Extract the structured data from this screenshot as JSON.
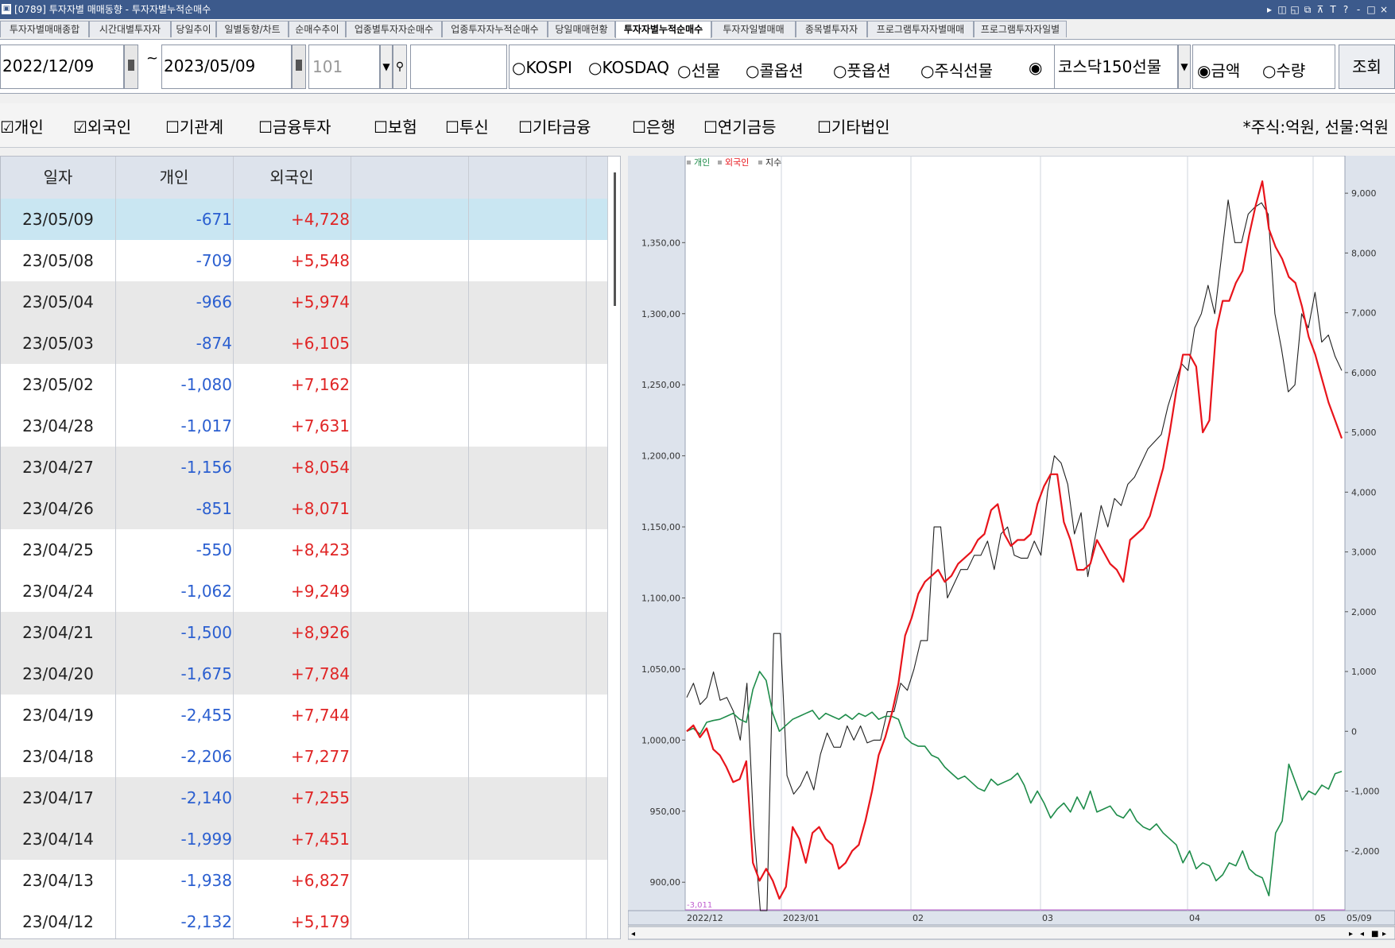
{
  "window": {
    "screen_no": "[0789]",
    "title": "투자자별 매매동향 - 투자자별누적순매수",
    "controls": [
      "▸",
      "◫",
      "◱",
      "⧉",
      "⊼",
      "T",
      "?",
      "-",
      "□",
      "×"
    ]
  },
  "tabs": [
    "투자자별매매종합",
    "시간대별투자자",
    "당일추이",
    "일별동향/차트",
    "순매수추이",
    "업종별투자자순매수",
    "업종투자자누적순매수",
    "당일매매현황",
    "투자자별누적순매수",
    "투자자일별매매",
    "종목별투자자",
    "프로그램투자자별매매",
    "프로그램투자자일별"
  ],
  "active_tab_index": 8,
  "toolbar": {
    "start_date": "2022/12/09",
    "tilde": "~",
    "end_date": "2023/05/09",
    "code": "101",
    "market_radios": [
      {
        "label": "KOSPI",
        "selected": false
      },
      {
        "label": "KOSDAQ",
        "selected": false
      },
      {
        "label": "선물",
        "selected": false
      },
      {
        "label": "콜옵션",
        "selected": false
      },
      {
        "label": "풋옵션",
        "selected": false
      },
      {
        "label": "주식선물",
        "selected": false
      }
    ],
    "extra_radio_selected": true,
    "product_select": "코스닥150선물",
    "amount_label": "금액",
    "qty_label": "수량",
    "query_button": "조회"
  },
  "investor_filters": [
    {
      "label": "개인",
      "checked": true
    },
    {
      "label": "외국인",
      "checked": true
    },
    {
      "label": "기관계",
      "checked": false
    },
    {
      "label": "금융투자",
      "checked": false
    },
    {
      "label": "보험",
      "checked": false
    },
    {
      "label": "투신",
      "checked": false
    },
    {
      "label": "기타금융",
      "checked": false
    },
    {
      "label": "은행",
      "checked": false
    },
    {
      "label": "연기금등",
      "checked": false
    },
    {
      "label": "기타법인",
      "checked": false
    }
  ],
  "unit_note": "*주식:억원, 선물:억원",
  "table": {
    "columns": [
      "일자",
      "개인",
      "외국인"
    ],
    "rows": [
      {
        "date": "23/05/09",
        "individual": "-671",
        "foreign": "+4,728"
      },
      {
        "date": "23/05/08",
        "individual": "-709",
        "foreign": "+5,548"
      },
      {
        "date": "23/05/04",
        "individual": "-966",
        "foreign": "+5,974"
      },
      {
        "date": "23/05/03",
        "individual": "-874",
        "foreign": "+6,105"
      },
      {
        "date": "23/05/02",
        "individual": "-1,080",
        "foreign": "+7,162"
      },
      {
        "date": "23/04/28",
        "individual": "-1,017",
        "foreign": "+7,631"
      },
      {
        "date": "23/04/27",
        "individual": "-1,156",
        "foreign": "+8,054"
      },
      {
        "date": "23/04/26",
        "individual": "-851",
        "foreign": "+8,071"
      },
      {
        "date": "23/04/25",
        "individual": "-550",
        "foreign": "+8,423"
      },
      {
        "date": "23/04/24",
        "individual": "-1,062",
        "foreign": "+9,249"
      },
      {
        "date": "23/04/21",
        "individual": "-1,500",
        "foreign": "+8,926"
      },
      {
        "date": "23/04/20",
        "individual": "-1,675",
        "foreign": "+7,784"
      },
      {
        "date": "23/04/19",
        "individual": "-2,455",
        "foreign": "+7,744"
      },
      {
        "date": "23/04/18",
        "individual": "-2,206",
        "foreign": "+7,277"
      },
      {
        "date": "23/04/17",
        "individual": "-2,140",
        "foreign": "+7,255"
      },
      {
        "date": "23/04/14",
        "individual": "-1,999",
        "foreign": "+7,451"
      },
      {
        "date": "23/04/13",
        "individual": "-1,938",
        "foreign": "+6,827"
      },
      {
        "date": "23/04/12",
        "individual": "-2,132",
        "foreign": "+5,179"
      }
    ]
  },
  "colors": {
    "individual": "#1e8c4a",
    "foreign": "#e8141b",
    "index": "#202020",
    "selected_row": "#c9e6f2",
    "minmark": "#c060d0"
  },
  "chart_data": {
    "type": "line",
    "legend": [
      "개인",
      "외국인",
      "지수"
    ],
    "legend_placement": "top-left",
    "x_labels": [
      "2022/12",
      "2023/01",
      "02",
      "03",
      "04",
      "05",
      "05/09"
    ],
    "left_axis": {
      "ticks": [
        "900,00",
        "950,00",
        "1,000,00",
        "1,050,00",
        "1,100,00",
        "1,150,00",
        "1,200,00",
        "1,250,00",
        "1,300,00",
        "1,350,00"
      ],
      "ylim": [
        880,
        1410
      ]
    },
    "right_axis": {
      "ticks": [
        "-2,000",
        "-1,000",
        "0",
        "1,000",
        "2,000",
        "3,000",
        "4,000",
        "5,000",
        "6,000",
        "7,000",
        "8,000",
        "9,000"
      ],
      "ylim": [
        -3000,
        9600
      ]
    },
    "min_label": "-3,011",
    "series": [
      {
        "name": "지수",
        "axis": "left",
        "values": [
          1030,
          1040,
          1025,
          1030,
          1048,
          1028,
          1030,
          1020,
          1000,
          1040,
          940,
          880,
          880,
          1075,
          1075,
          975,
          962,
          968,
          978,
          965,
          990,
          1005,
          995,
          995,
          1010,
          1000,
          1010,
          998,
          1000,
          1000,
          1020,
          1020,
          1040,
          1035,
          1050,
          1070,
          1070,
          1150,
          1150,
          1100,
          1110,
          1120,
          1120,
          1130,
          1130,
          1140,
          1120,
          1145,
          1150,
          1130,
          1128,
          1128,
          1140,
          1130,
          1175,
          1200,
          1195,
          1180,
          1145,
          1160,
          1115,
          1140,
          1165,
          1150,
          1170,
          1165,
          1180,
          1185,
          1195,
          1205,
          1210,
          1215,
          1235,
          1250,
          1265,
          1260,
          1290,
          1300,
          1320,
          1300,
          1340,
          1380,
          1350,
          1350,
          1370,
          1375,
          1378,
          1370,
          1300,
          1275,
          1245,
          1250,
          1300,
          1290,
          1315,
          1280,
          1285,
          1270,
          1260
        ]
      },
      {
        "name": "개인",
        "axis": "right",
        "values": [
          0,
          50,
          -50,
          150,
          180,
          200,
          250,
          300,
          200,
          150,
          700,
          1000,
          850,
          300,
          0,
          100,
          200,
          250,
          300,
          350,
          200,
          300,
          250,
          200,
          280,
          200,
          300,
          250,
          320,
          200,
          250,
          250,
          200,
          -100,
          -200,
          -250,
          -250,
          -400,
          -450,
          -600,
          -700,
          -800,
          -750,
          -850,
          -950,
          -1000,
          -800,
          -900,
          -850,
          -800,
          -700,
          -900,
          -1200,
          -1000,
          -1200,
          -1450,
          -1300,
          -1200,
          -1350,
          -1100,
          -1300,
          -1000,
          -1350,
          -1300,
          -1250,
          -1400,
          -1450,
          -1300,
          -1500,
          -1600,
          -1650,
          -1550,
          -1700,
          -1800,
          -1900,
          -2200,
          -2000,
          -2300,
          -2200,
          -2250,
          -2500,
          -2400,
          -2200,
          -2250,
          -2000,
          -2300,
          -2400,
          -2450,
          -2750,
          -1700,
          -1500,
          -550,
          -850,
          -1150,
          -1000,
          -1060,
          -900,
          -966,
          -709,
          -671
        ]
      },
      {
        "name": "외국인",
        "axis": "right",
        "values": [
          0,
          100,
          -100,
          50,
          -300,
          -400,
          -600,
          -850,
          -800,
          -500,
          -2200,
          -2500,
          -2300,
          -2500,
          -2800,
          -2600,
          -1600,
          -1800,
          -2200,
          -1700,
          -1600,
          -1800,
          -1900,
          -2300,
          -2200,
          -2000,
          -1900,
          -1500,
          -1000,
          -400,
          -100,
          300,
          800,
          1600,
          1900,
          2300,
          2500,
          2600,
          2700,
          2500,
          2600,
          2800,
          2900,
          3000,
          3200,
          3300,
          3700,
          3800,
          3300,
          3100,
          3200,
          3200,
          3300,
          3800,
          4100,
          4300,
          4300,
          3500,
          3200,
          2700,
          2700,
          2800,
          3200,
          3000,
          2800,
          2700,
          2500,
          3200,
          3300,
          3400,
          3600,
          4000,
          4400,
          5000,
          5700,
          6300,
          6300,
          6100,
          5000,
          5200,
          6700,
          7200,
          7200,
          7500,
          7700,
          8300,
          8800,
          9200,
          8400,
          8100,
          7900,
          7600,
          7500,
          7100,
          6600,
          6300,
          5900,
          5500,
          5200,
          4900
        ]
      }
    ]
  }
}
